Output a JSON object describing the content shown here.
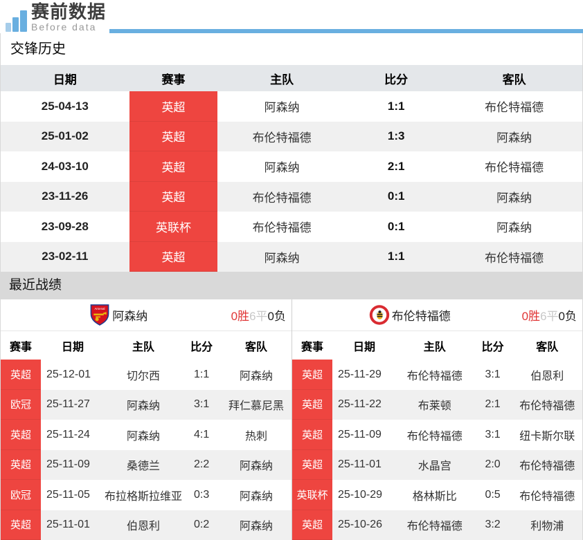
{
  "brand": {
    "title": "赛前数据",
    "subtitle": "Before data"
  },
  "colors": {
    "accent_blue": "#69afe0",
    "badge_red": "#ee4540",
    "win_red": "#e03636",
    "draw_gray": "#c8c8c8",
    "loss_black": "#222222",
    "alt_row_gray": "#f0f0f0",
    "header_gray": "#e4e7ea",
    "section_bar_gray": "#d9d9d9"
  },
  "h2h": {
    "title": "交锋历史",
    "columns": [
      "日期",
      "赛事",
      "主队",
      "比分",
      "客队"
    ],
    "rows": [
      {
        "date": "25-04-13",
        "comp": "英超",
        "home": "阿森纳",
        "score": "1:1",
        "away": "布伦特福德"
      },
      {
        "date": "25-01-02",
        "comp": "英超",
        "home": "布伦特福德",
        "score": "1:3",
        "away": "阿森纳"
      },
      {
        "date": "24-03-10",
        "comp": "英超",
        "home": "阿森纳",
        "score": "2:1",
        "away": "布伦特福德"
      },
      {
        "date": "23-11-26",
        "comp": "英超",
        "home": "布伦特福德",
        "score": "0:1",
        "away": "阿森纳"
      },
      {
        "date": "23-09-28",
        "comp": "英联杯",
        "home": "布伦特福德",
        "score": "0:1",
        "away": "阿森纳"
      },
      {
        "date": "23-02-11",
        "comp": "英超",
        "home": "阿森纳",
        "score": "1:1",
        "away": "布伦特福德"
      }
    ]
  },
  "recent": {
    "title": "最近战绩",
    "columns": [
      "赛事",
      "日期",
      "主队",
      "比分",
      "客队"
    ],
    "panels": [
      {
        "team": "阿森纳",
        "crest": "arsenal-crest",
        "record": {
          "wins": "0胜",
          "draws": "6平",
          "losses": "0负"
        },
        "rows": [
          {
            "comp": "英超",
            "date": "25-12-01",
            "home": "切尔西",
            "score": "1:1",
            "away": "阿森纳"
          },
          {
            "comp": "欧冠",
            "date": "25-11-27",
            "home": "阿森纳",
            "score": "3:1",
            "away": "拜仁慕尼黑"
          },
          {
            "comp": "英超",
            "date": "25-11-24",
            "home": "阿森纳",
            "score": "4:1",
            "away": "热刺"
          },
          {
            "comp": "英超",
            "date": "25-11-09",
            "home": "桑德兰",
            "score": "2:2",
            "away": "阿森纳"
          },
          {
            "comp": "欧冠",
            "date": "25-11-05",
            "home": "布拉格斯拉维亚",
            "score": "0:3",
            "away": "阿森纳"
          },
          {
            "comp": "英超",
            "date": "25-11-01",
            "home": "伯恩利",
            "score": "0:2",
            "away": "阿森纳"
          }
        ]
      },
      {
        "team": "布伦特福德",
        "crest": "brentford-crest",
        "record": {
          "wins": "0胜",
          "draws": "6平",
          "losses": "0负"
        },
        "rows": [
          {
            "comp": "英超",
            "date": "25-11-29",
            "home": "布伦特福德",
            "score": "3:1",
            "away": "伯恩利"
          },
          {
            "comp": "英超",
            "date": "25-11-22",
            "home": "布莱顿",
            "score": "2:1",
            "away": "布伦特福德"
          },
          {
            "comp": "英超",
            "date": "25-11-09",
            "home": "布伦特福德",
            "score": "3:1",
            "away": "纽卡斯尔联"
          },
          {
            "comp": "英超",
            "date": "25-11-01",
            "home": "水晶宫",
            "score": "2:0",
            "away": "布伦特福德"
          },
          {
            "comp": "英联杯",
            "date": "25-10-29",
            "home": "格林斯比",
            "score": "0:5",
            "away": "布伦特福德"
          },
          {
            "comp": "英超",
            "date": "25-10-26",
            "home": "布伦特福德",
            "score": "3:2",
            "away": "利物浦"
          }
        ]
      }
    ]
  }
}
